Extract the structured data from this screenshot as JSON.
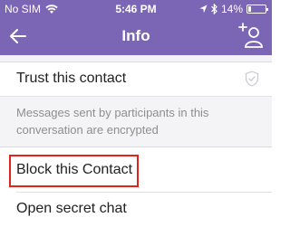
{
  "status_bar": {
    "carrier": "No SIM",
    "time": "5:46 PM",
    "battery_percent": "14%",
    "battery_level": 0.14
  },
  "header": {
    "title": "Info",
    "background_color": "#7b66b6"
  },
  "rows": {
    "trust_label": "Trust this contact",
    "encryption_note": "Messages sent by participants in this conversation are encrypted",
    "block_label": "Block this Contact",
    "secret_chat_label": "Open secret chat"
  },
  "highlight_color": "#e2231a",
  "icons": {
    "back": "arrow-left-icon",
    "add_participant": "add-user-icon",
    "trust": "shield-icon",
    "wifi": "wifi-icon",
    "location": "location-arrow-icon",
    "bluetooth": "bluetooth-icon",
    "battery": "battery-icon"
  }
}
